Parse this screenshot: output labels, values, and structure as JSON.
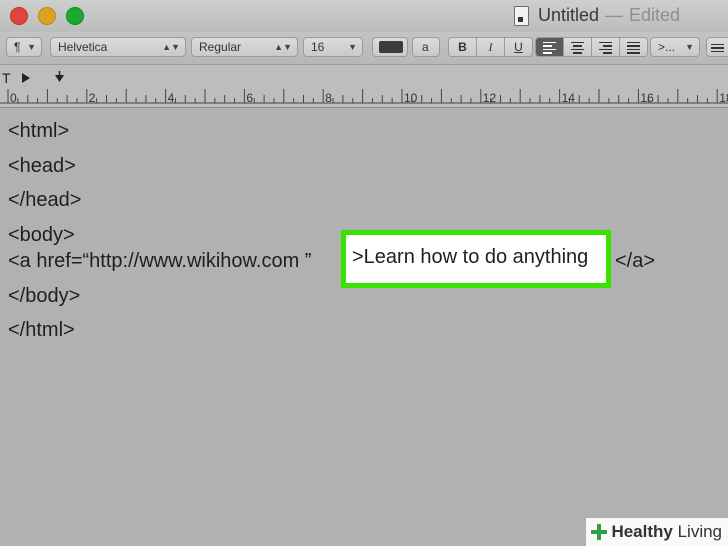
{
  "window": {
    "title": "Untitled",
    "separator": "—",
    "state": "Edited"
  },
  "toolbar": {
    "paragraph_style_label": "¶",
    "font_family": "Helvetica",
    "font_style": "Regular",
    "font_size": "16",
    "text_color_hex": "#3c3c3c",
    "highlight_label": "a",
    "bold_label": "B",
    "italic_label": "I",
    "underline_label": "U",
    "alignment": [
      "left",
      "center",
      "right",
      "justify"
    ],
    "active_alignment": "left",
    "spacing_label": ">..."
  },
  "ruler": {
    "numbers": [
      "0",
      "2",
      "4",
      "6",
      "8",
      "10",
      "12",
      "14",
      "16",
      "18"
    ]
  },
  "document": {
    "lines": [
      "<html>",
      "<head>",
      "</head>",
      "<body>",
      "<a href=“http://www.wikihow.com ”",
      "</body>",
      "</html>"
    ],
    "highlighted_text": ">Learn how to do anything",
    "closing_tag": "</a>",
    "highlight_color": "#39e200"
  },
  "watermark": {
    "brand_bold": "Healthy",
    "brand_rest": " Living"
  }
}
